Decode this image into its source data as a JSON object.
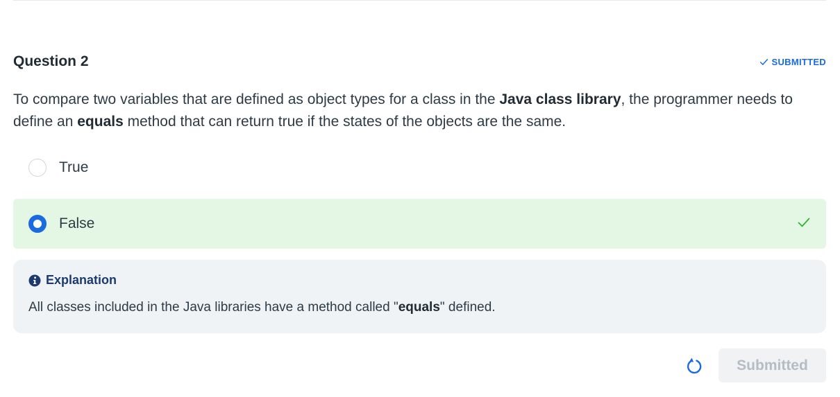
{
  "question": {
    "title": "Question 2",
    "status": "SUBMITTED",
    "text_parts": {
      "p1": "To compare two variables that are defined as object types for a class in the ",
      "b1": "Java class library",
      "p2": ", the programmer needs to define an ",
      "b2": "equals",
      "p3": " method that can return true if the states of the objects are the same."
    }
  },
  "options": [
    {
      "label": "True",
      "selected": false,
      "correct": false
    },
    {
      "label": "False",
      "selected": true,
      "correct": true
    }
  ],
  "explanation": {
    "heading": "Explanation",
    "text_parts": {
      "p1": "All classes included in the Java libraries have a method called \"",
      "b1": "equals",
      "p2": "\" defined."
    }
  },
  "actions": {
    "retry_icon": "retry-icon",
    "submit_label": "Submitted"
  },
  "colors": {
    "accent": "#1a6ae0",
    "correct_bg": "#e4f7e4",
    "correct_check": "#2fb52f",
    "explanation_bg": "#f0f3f6"
  }
}
